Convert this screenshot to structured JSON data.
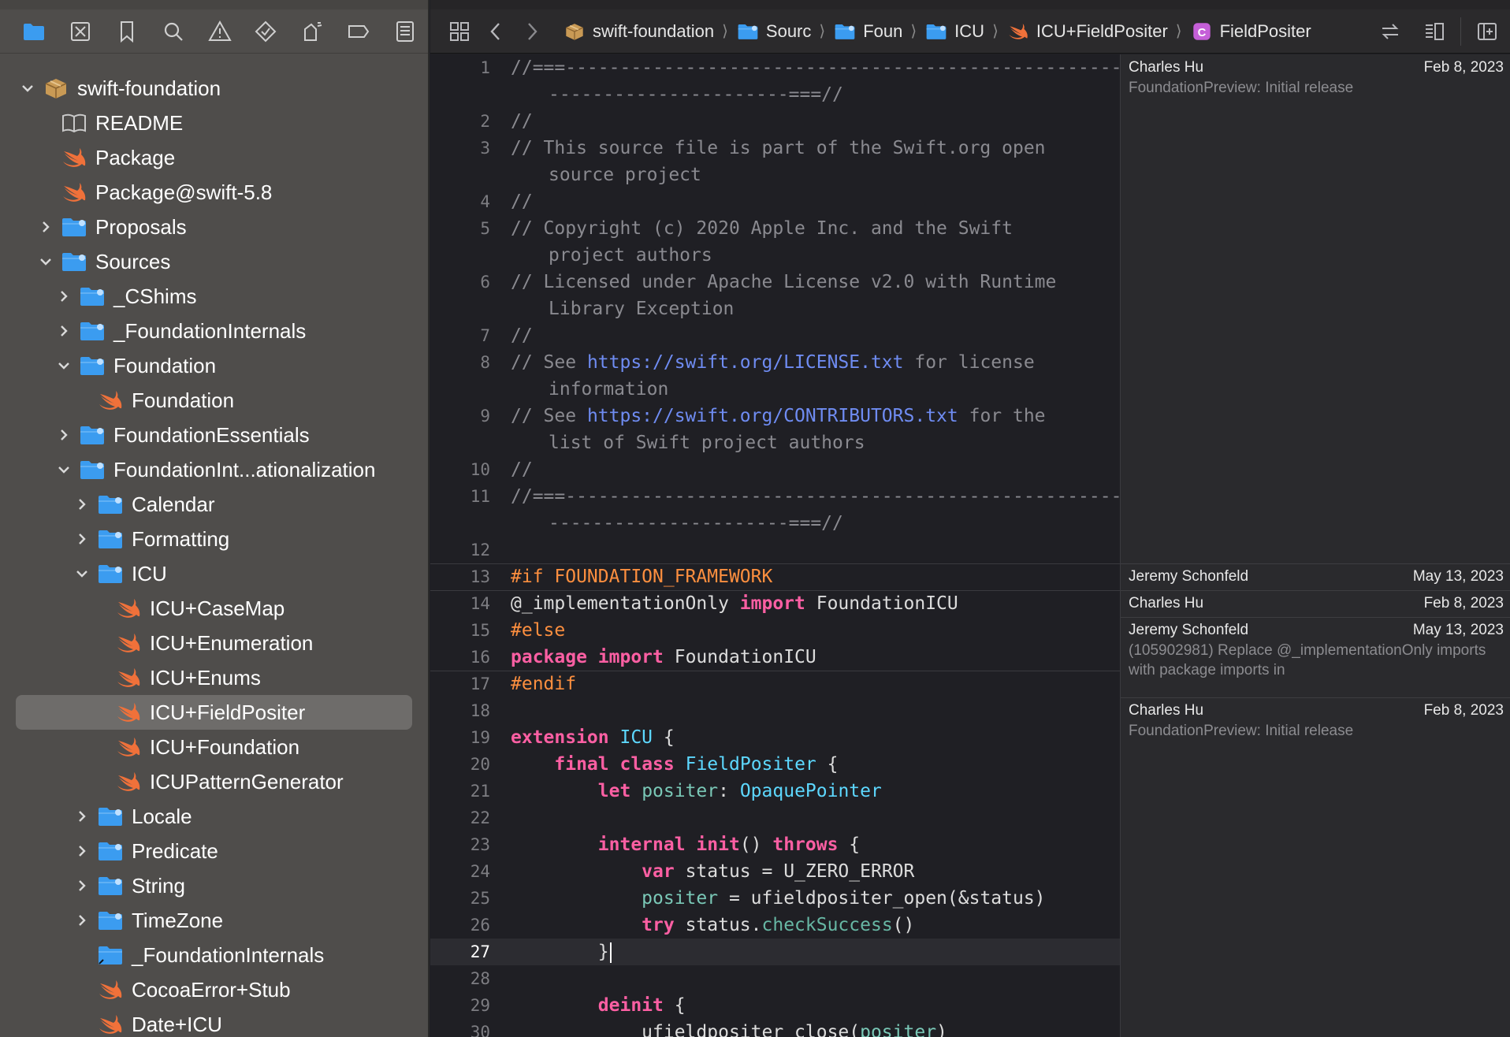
{
  "sidebar": {
    "nav_icons": [
      "folder-icon",
      "source-control-icon",
      "bookmark-icon",
      "search-icon",
      "warning-icon",
      "test-icon",
      "debug-icon",
      "breakpoint-icon",
      "report-icon"
    ],
    "tree": [
      {
        "label": "swift-foundation",
        "icon": "package-icon",
        "depth": 0,
        "chevron": "down"
      },
      {
        "label": "README",
        "icon": "book-icon",
        "depth": 1,
        "chevron": "none"
      },
      {
        "label": "Package",
        "icon": "swift-icon",
        "depth": 1,
        "chevron": "none"
      },
      {
        "label": "Package@swift-5.8",
        "icon": "swift-icon",
        "depth": 1,
        "chevron": "none"
      },
      {
        "label": "Proposals",
        "icon": "folder-icon",
        "depth": 1,
        "chevron": "right"
      },
      {
        "label": "Sources",
        "icon": "folder-icon",
        "depth": 1,
        "chevron": "down"
      },
      {
        "label": "_CShims",
        "icon": "folder-icon",
        "depth": 2,
        "chevron": "right"
      },
      {
        "label": "_FoundationInternals",
        "icon": "folder-icon",
        "depth": 2,
        "chevron": "right"
      },
      {
        "label": "Foundation",
        "icon": "folder-icon",
        "depth": 2,
        "chevron": "down"
      },
      {
        "label": "Foundation",
        "icon": "swift-icon",
        "depth": 3,
        "chevron": "none"
      },
      {
        "label": "FoundationEssentials",
        "icon": "folder-icon",
        "depth": 2,
        "chevron": "right"
      },
      {
        "label": "FoundationInt...ationalization",
        "icon": "folder-icon",
        "depth": 2,
        "chevron": "down"
      },
      {
        "label": "Calendar",
        "icon": "folder-icon",
        "depth": 3,
        "chevron": "right"
      },
      {
        "label": "Formatting",
        "icon": "folder-icon",
        "depth": 3,
        "chevron": "right"
      },
      {
        "label": "ICU",
        "icon": "folder-icon",
        "depth": 3,
        "chevron": "down"
      },
      {
        "label": "ICU+CaseMap",
        "icon": "swift-icon",
        "depth": 4,
        "chevron": "none"
      },
      {
        "label": "ICU+Enumeration",
        "icon": "swift-icon",
        "depth": 4,
        "chevron": "none"
      },
      {
        "label": "ICU+Enums",
        "icon": "swift-icon",
        "depth": 4,
        "chevron": "none"
      },
      {
        "label": "ICU+FieldPositer",
        "icon": "swift-icon",
        "depth": 4,
        "chevron": "none",
        "selected": true
      },
      {
        "label": "ICU+Foundation",
        "icon": "swift-icon",
        "depth": 4,
        "chevron": "none"
      },
      {
        "label": "ICUPatternGenerator",
        "icon": "swift-icon",
        "depth": 4,
        "chevron": "none"
      },
      {
        "label": "Locale",
        "icon": "folder-icon",
        "depth": 3,
        "chevron": "right"
      },
      {
        "label": "Predicate",
        "icon": "folder-icon",
        "depth": 3,
        "chevron": "right"
      },
      {
        "label": "String",
        "icon": "folder-icon",
        "depth": 3,
        "chevron": "right"
      },
      {
        "label": "TimeZone",
        "icon": "folder-icon",
        "depth": 3,
        "chevron": "right"
      },
      {
        "label": "_FoundationInternals",
        "icon": "alias-folder-icon",
        "depth": 3,
        "chevron": "none"
      },
      {
        "label": "CocoaError+Stub",
        "icon": "swift-icon",
        "depth": 3,
        "chevron": "none"
      },
      {
        "label": "Date+ICU",
        "icon": "swift-icon",
        "depth": 3,
        "chevron": "none"
      }
    ]
  },
  "topbar": {
    "breadcrumbs": [
      {
        "label": "swift-foundation",
        "icon": "package-icon"
      },
      {
        "label": "Sourc",
        "icon": "folder-icon"
      },
      {
        "label": "Foun",
        "icon": "folder-icon"
      },
      {
        "label": "ICU",
        "icon": "folder-icon"
      },
      {
        "label": "ICU+FieldPositer",
        "icon": "swift-icon"
      },
      {
        "label": "FieldPositer",
        "icon": "class-icon",
        "badge": "C"
      }
    ]
  },
  "editor": {
    "current_line": 27,
    "lines": [
      {
        "n": "1",
        "t": [
          [
            "cmt",
            "//===----------------------------------------------------------------------===//"
          ]
        ]
      },
      {
        "n": "",
        "t": []
      },
      {
        "n": "2",
        "t": [
          [
            "cmt",
            "//"
          ]
        ]
      },
      {
        "n": "3",
        "t": [
          [
            "cmt",
            "// This source file is part of the Swift.org open source project"
          ]
        ]
      },
      {
        "n": "",
        "t": []
      },
      {
        "n": "4",
        "t": [
          [
            "cmt",
            "//"
          ]
        ]
      },
      {
        "n": "5",
        "t": [
          [
            "cmt",
            "// Copyright (c) 2020 Apple Inc. and the Swift project authors"
          ]
        ]
      },
      {
        "n": "",
        "t": []
      },
      {
        "n": "6",
        "t": [
          [
            "cmt",
            "// Licensed under Apache License v2.0 with Runtime Library Exception"
          ]
        ]
      },
      {
        "n": "",
        "t": []
      },
      {
        "n": "7",
        "t": [
          [
            "cmt",
            "//"
          ]
        ]
      },
      {
        "n": "8",
        "t": [
          [
            "cmt",
            "// See "
          ],
          [
            "url",
            "https://swift.org/LICENSE.txt"
          ],
          [
            "cmt",
            " for license information"
          ]
        ]
      },
      {
        "n": "",
        "t": []
      },
      {
        "n": "9",
        "t": [
          [
            "cmt",
            "// See "
          ],
          [
            "url",
            "https://swift.org/CONTRIBUTORS.txt"
          ],
          [
            "cmt",
            " for the list of Swift project authors"
          ]
        ]
      },
      {
        "n": "",
        "t": []
      },
      {
        "n": "10",
        "t": [
          [
            "cmt",
            "//"
          ]
        ]
      },
      {
        "n": "11",
        "t": [
          [
            "cmt",
            "//===----------------------------------------------------------------------===//"
          ]
        ]
      },
      {
        "n": "",
        "t": []
      },
      {
        "n": "12",
        "t": []
      },
      {
        "n": "13",
        "t": [
          [
            "pp",
            "#if FOUNDATION_FRAMEWORK"
          ]
        ]
      },
      {
        "n": "14",
        "t": [
          [
            "",
            "@_implementationOnly "
          ],
          [
            "kw",
            "import"
          ],
          [
            "",
            " FoundationICU"
          ]
        ]
      },
      {
        "n": "15",
        "t": [
          [
            "pp",
            "#else"
          ]
        ]
      },
      {
        "n": "16",
        "t": [
          [
            "kw",
            "package"
          ],
          [
            "",
            " "
          ],
          [
            "kw",
            "import"
          ],
          [
            "",
            " FoundationICU"
          ]
        ]
      },
      {
        "n": "17",
        "t": [
          [
            "pp",
            "#endif"
          ]
        ]
      },
      {
        "n": "18",
        "t": []
      },
      {
        "n": "19",
        "t": [
          [
            "kw",
            "extension"
          ],
          [
            "",
            " "
          ],
          [
            "ty",
            "ICU"
          ],
          [
            "",
            " {"
          ]
        ]
      },
      {
        "n": "20",
        "t": [
          [
            "",
            "    "
          ],
          [
            "kw",
            "final"
          ],
          [
            "",
            " "
          ],
          [
            "kw",
            "class"
          ],
          [
            "",
            " "
          ],
          [
            "cls",
            "FieldPositer"
          ],
          [
            "",
            " {"
          ]
        ]
      },
      {
        "n": "21",
        "t": [
          [
            "",
            "        "
          ],
          [
            "kw",
            "let"
          ],
          [
            "",
            " "
          ],
          [
            "prop",
            "positer"
          ],
          [
            "",
            ": "
          ],
          [
            "ty",
            "OpaquePointer"
          ]
        ]
      },
      {
        "n": "22",
        "t": []
      },
      {
        "n": "23",
        "t": [
          [
            "",
            "        "
          ],
          [
            "kw",
            "internal"
          ],
          [
            "",
            " "
          ],
          [
            "kw",
            "init"
          ],
          [
            "",
            "() "
          ],
          [
            "kw",
            "throws"
          ],
          [
            "",
            " {"
          ]
        ]
      },
      {
        "n": "24",
        "t": [
          [
            "",
            "            "
          ],
          [
            "kw",
            "var"
          ],
          [
            "",
            " status = U_ZERO_ERROR"
          ]
        ]
      },
      {
        "n": "25",
        "t": [
          [
            "",
            "            "
          ],
          [
            "prop",
            "positer"
          ],
          [
            "",
            " = ufieldpositer_open(&status)"
          ]
        ]
      },
      {
        "n": "26",
        "t": [
          [
            "",
            "            "
          ],
          [
            "kw",
            "try"
          ],
          [
            "",
            " status."
          ],
          [
            "fn",
            "checkSuccess"
          ],
          [
            "",
            "()"
          ]
        ]
      },
      {
        "n": "27",
        "t": [
          [
            "",
            "        }"
          ]
        ]
      },
      {
        "n": "28",
        "t": []
      },
      {
        "n": "29",
        "t": [
          [
            "",
            "        "
          ],
          [
            "kw",
            "deinit"
          ],
          [
            "",
            " {"
          ]
        ]
      },
      {
        "n": "30",
        "t": [
          [
            "",
            "            ufieldpositer_close("
          ],
          [
            "prop",
            "positer"
          ],
          [
            "",
            ")"
          ]
        ]
      }
    ],
    "wrapped_continuations": {
      "1": "----------------------===//",
      "3": "source project",
      "5": "project authors",
      "6": "Library Exception",
      "8": "information",
      "9": "list of Swift project authors",
      "11": "----------------------===//"
    }
  },
  "blame": [
    {
      "author": "Charles Hu",
      "date": "Feb 8, 2023",
      "message": "FoundationPreview: Initial release"
    },
    {
      "author": "Jeremy Schonfeld",
      "date": "May 13, 2023",
      "message": ""
    },
    {
      "author": "Charles Hu",
      "date": "Feb 8, 2023",
      "message": ""
    },
    {
      "author": "Jeremy Schonfeld",
      "date": "May 13, 2023",
      "message": "(105902981) Replace @_implementationOnly imports with package imports in"
    },
    {
      "author": "Charles Hu",
      "date": "Feb 8, 2023",
      "message": "FoundationPreview: Initial release"
    }
  ],
  "colors": {
    "accent_folder": "#3b9cf0",
    "swift": "#f0713a",
    "selection": "#6e6c6a"
  }
}
